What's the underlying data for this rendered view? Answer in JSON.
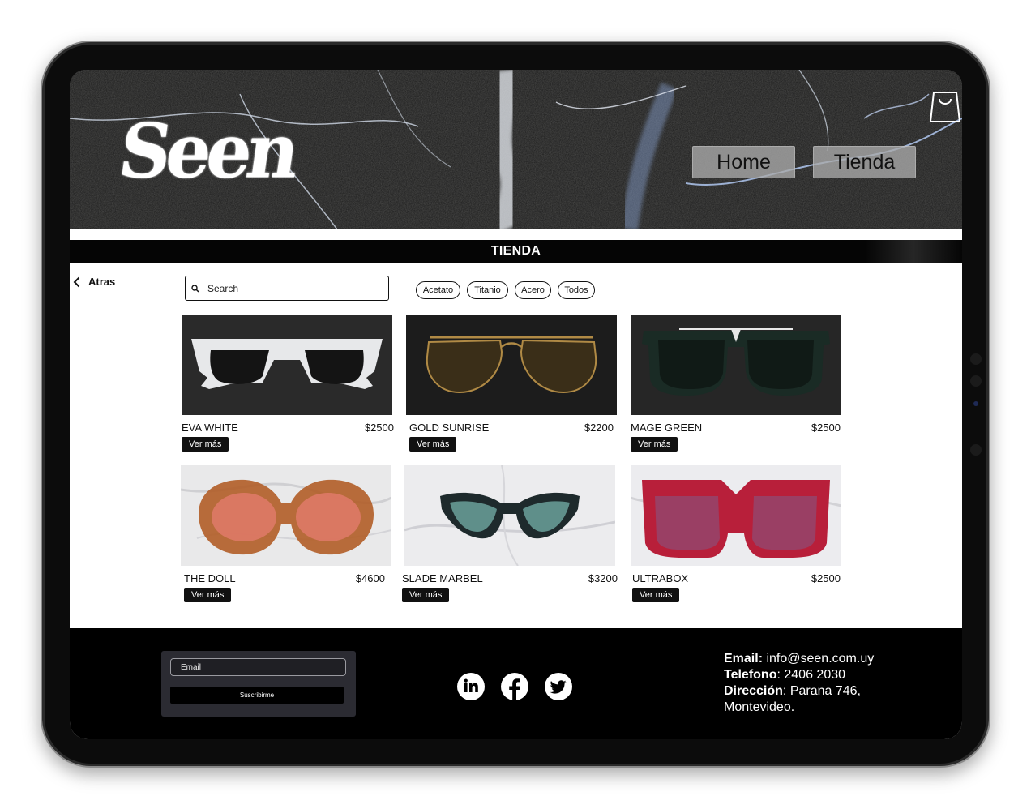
{
  "header": {
    "logo_text": "Seen",
    "nav": [
      {
        "label": "Home"
      },
      {
        "label": "Tienda"
      }
    ]
  },
  "section_title": "TIENDA",
  "back_label": "Atras",
  "search": {
    "placeholder": "Search",
    "value": ""
  },
  "filters": [
    {
      "label": "Acetato"
    },
    {
      "label": "Titanio"
    },
    {
      "label": "Acero"
    },
    {
      "label": "Todos"
    }
  ],
  "products": [
    {
      "name": "EVA WHITE",
      "price": "$2500",
      "cta": "Ver más"
    },
    {
      "name": "GOLD SUNRISE",
      "price": "$2200",
      "cta": "Ver más"
    },
    {
      "name": "MAGE GREEN",
      "price": "$2500",
      "cta": "Ver más"
    },
    {
      "name": "THE DOLL",
      "price": "$4600",
      "cta": "Ver más"
    },
    {
      "name": "SLADE MARBEL",
      "price": "$3200",
      "cta": "Ver más"
    },
    {
      "name": "ULTRABOX",
      "price": "$2500",
      "cta": "Ver más"
    }
  ],
  "footer": {
    "subscribe": {
      "email_placeholder": "Email",
      "button_label": "Suscribirme"
    },
    "social_icons": [
      "linkedin-icon",
      "facebook-icon",
      "twitter-icon"
    ],
    "contact": {
      "email_label": "Email",
      "email_value": "info@seen.com.uy",
      "phone_label": "Telefono",
      "phone_value": "2406 2030",
      "address_label": "Dirección",
      "address_value": "Parana 746,",
      "address_city": "Montevideo."
    }
  },
  "colors": {
    "accent": "#111111",
    "footer_bg": "#000000",
    "nav_button": "#aaaaaa"
  }
}
